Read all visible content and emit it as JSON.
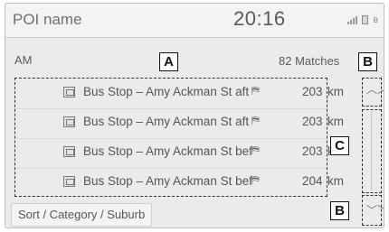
{
  "header": {
    "title": "POI name",
    "time": "20:16"
  },
  "status_icons": [
    "signal-icon",
    "battery-icon",
    "bluetooth-icon"
  ],
  "list_header": {
    "label": "AM",
    "matches": "82 Matches"
  },
  "results": [
    {
      "name": "Bus Stop – Amy Ackman St aft",
      "direction": "⛿",
      "distance": "203",
      "unit": "km"
    },
    {
      "name": "Bus Stop – Amy Ackman St aft",
      "direction": "⛿",
      "distance": "203",
      "unit": "km"
    },
    {
      "name": "Bus Stop – Amy Ackman St bef",
      "direction": "⛿",
      "distance": "203",
      "unit": "km"
    },
    {
      "name": "Bus Stop – Amy Ackman St bef",
      "direction": "⛿",
      "distance": "204",
      "unit": "km"
    }
  ],
  "sort_button": "Sort / Category / Suburb",
  "scroll": {
    "up_icon": "double-chevron-up-icon",
    "down_icon": "double-chevron-down-icon",
    "up_glyph": "︿︿",
    "down_glyph": "﹀﹀"
  },
  "callouts": {
    "a": "A",
    "b_top": "B",
    "c": "C",
    "b_bottom": "B"
  }
}
